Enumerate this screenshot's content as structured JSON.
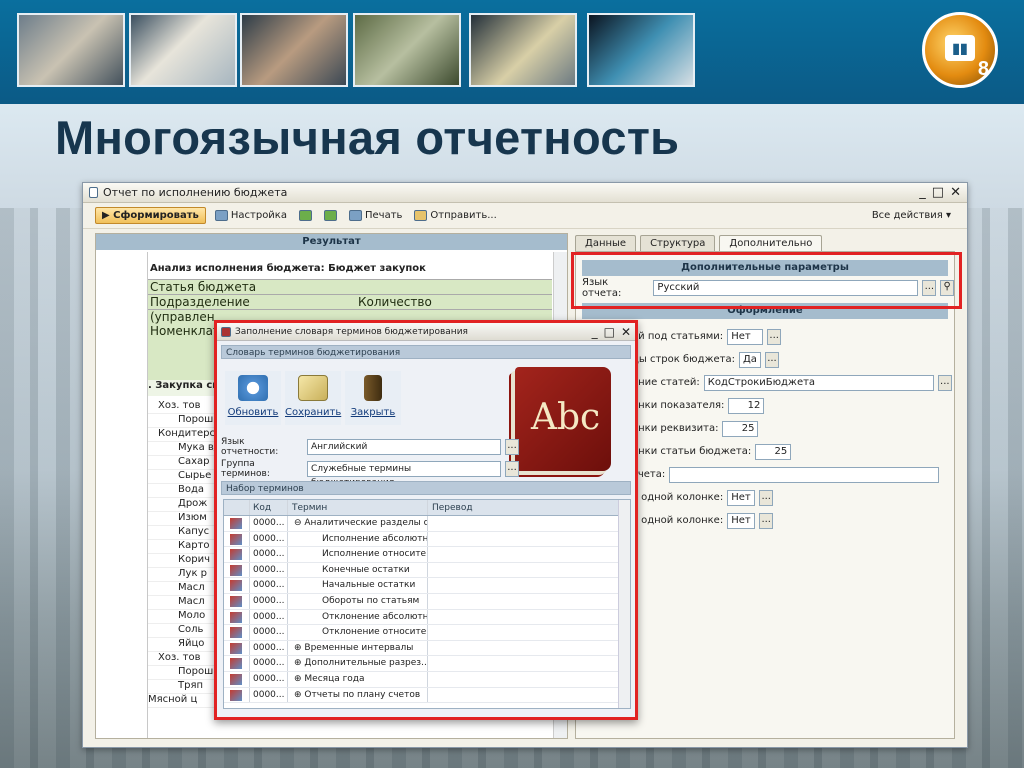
{
  "slide_title": "Многоязычная отчетность",
  "logo_text": "8",
  "window": {
    "title": "Отчет по исполнению бюджета",
    "controls": [
      "_",
      "□",
      "✕"
    ]
  },
  "toolbar": {
    "generate": "Сформировать",
    "settings": "Настройка",
    "print": "Печать",
    "send": "Отправить...",
    "all_actions": "Все действия ▾"
  },
  "result_header": "Результат",
  "report": {
    "title": "Анализ исполнения бюджета: Бюджет закупок",
    "budget_item": "Статья бюджета",
    "division": "Подразделение",
    "division2": "(управлен",
    "qty": "Количество",
    "nomenclature": "Номенклат",
    "purchases": ". Закупка сы",
    "items": [
      "Хоз. тов",
      "Порош",
      "Кондитерс",
      "Мука в/с",
      "Сахар",
      "Сырье и",
      "Вода",
      "Дрож",
      "Изюм",
      "Капус",
      "Карто",
      "Корич",
      "Лук р",
      "Масл",
      "Масл",
      "Моло",
      "Соль",
      "Яйцо",
      "Хоз. тов",
      "Порош",
      "Тряп",
      "Мясной ц"
    ]
  },
  "tabs": [
    "Данные",
    "Структура",
    "Дополнительно"
  ],
  "right": {
    "extra_params": "Дополнительные параметры",
    "lang_label": "Язык отчета:",
    "lang_value": "Русский",
    "design": "Оформление",
    "rows": [
      {
        "label": "ей под статьями:",
        "value": "Нет"
      },
      {
        "label": "ды строк бюджета:",
        "value": "Да"
      },
      {
        "label": "ание статей:",
        "value": "КодСтрокиБюджета"
      },
      {
        "label": "онки показателя:",
        "value": "12"
      },
      {
        "label": "онки реквизита:",
        "value": "25"
      },
      {
        "label": "онки статьи бюджета:",
        "value": "25"
      },
      {
        "label": "тчета:",
        "value": ""
      },
      {
        "label": "в одной колонке:",
        "value": "Нет"
      },
      {
        "label": "в одной колонке:",
        "value": "Нет"
      }
    ]
  },
  "dialog": {
    "title": "Заполнение словаря терминов бюджетирования",
    "section": "Словарь терминов бюджетирования",
    "refresh": "Обновить",
    "save": "Сохранить",
    "close": "Закрыть",
    "book_text": "Abc",
    "lang_label": "Язык отчетности:",
    "lang_value": "Английский",
    "group_label": "Группа терминов:",
    "group_value": "Служебные термины бюджетирования",
    "set_section": "Набор терминов",
    "cols": [
      "Код",
      "Термин",
      "Перевод"
    ],
    "rows": [
      {
        "code": "0000...",
        "term": "⊖ Аналитические разделы о..."
      },
      {
        "code": "0000...",
        "term": "Исполнение абсолютн..."
      },
      {
        "code": "0000...",
        "term": "Исполнение относите..."
      },
      {
        "code": "0000...",
        "term": "Конечные остатки"
      },
      {
        "code": "0000...",
        "term": "Начальные остатки"
      },
      {
        "code": "0000...",
        "term": "Обороты по статьям"
      },
      {
        "code": "0000...",
        "term": "Отклонение абсолютн..."
      },
      {
        "code": "0000...",
        "term": "Отклонение относите..."
      },
      {
        "code": "0000...",
        "term": "⊕ Временные интервалы"
      },
      {
        "code": "0000...",
        "term": "⊕ Дополнительные разрез..."
      },
      {
        "code": "0000...",
        "term": "⊕ Месяца года"
      },
      {
        "code": "0000...",
        "term": "⊕ Отчеты по плану счетов"
      }
    ]
  },
  "colors": {
    "highlight": "#e12222",
    "section": "#a5bccd",
    "topbar": "#0b5a86"
  }
}
